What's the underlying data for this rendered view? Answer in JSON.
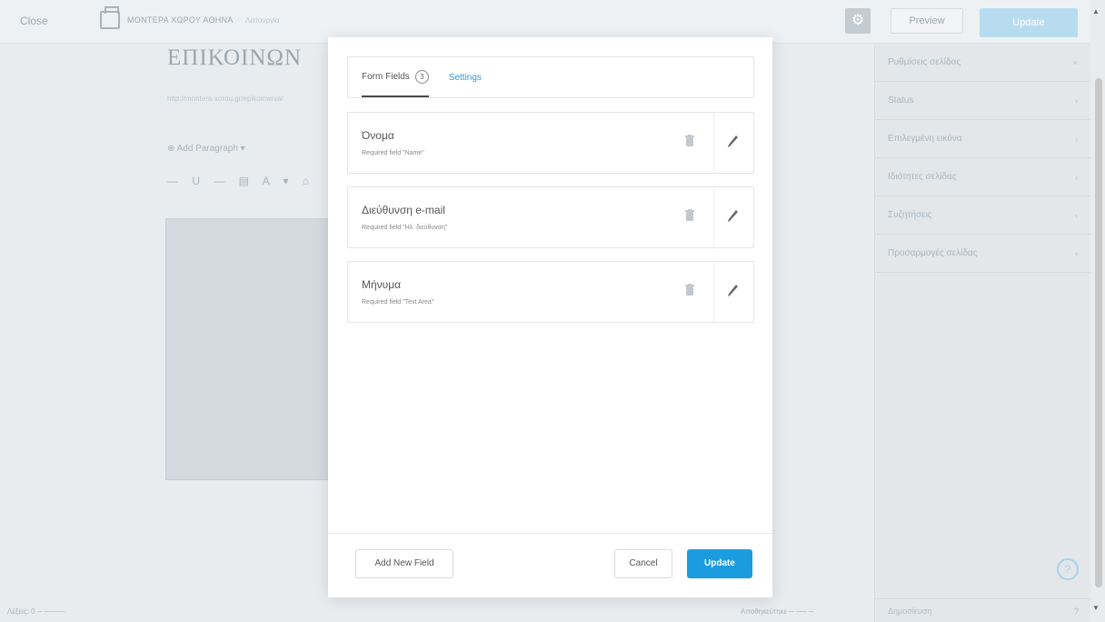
{
  "topbar": {
    "close": "Close",
    "site_name": "ΜΟΝΤΕΡΑ ΧΩΡΟΥ ΑΘΗΝΑ",
    "site_sub": "Λειτουργία",
    "preview": "Preview",
    "publish": "Update"
  },
  "editor": {
    "page_title": "ΕΠΙΚΟΙΝΩΝ",
    "permalink": "http://montera-xorou.gr/epikoinwnia/",
    "toolbar_row1": "⊕ Add   Paragraph  ▾",
    "toolbar_row2": "— U — ▤ A ▾ ⌂",
    "footer_left": "Λέξεις: 0 ─ ────",
    "footer_mid": "Αποθηκεύτηκε ─ ── ─"
  },
  "sidebar": {
    "items": [
      {
        "label": "Ρυθμίσεις σελίδας",
        "chev": "×"
      },
      {
        "label": "Status",
        "chev": "›"
      },
      {
        "label": "Επιλεγμένη εικόνα",
        "chev": "›"
      },
      {
        "label": "Ιδιότητες σελίδας",
        "chev": "›"
      },
      {
        "label": "Συζητήσεις",
        "chev": "›"
      },
      {
        "label": "Προσαρμογές σελίδας",
        "chev": "›"
      }
    ],
    "footer_label": "Δημοσίευση",
    "help": "?"
  },
  "modal": {
    "tabs": [
      {
        "label": "Form Fields",
        "count": "3"
      },
      {
        "label": "Settings"
      }
    ],
    "fields": [
      {
        "title": "Όνομα",
        "subtitle": "Required field \"Name\""
      },
      {
        "title": "Διεύθυνση e-mail",
        "subtitle": "Required field \"Ηλ. διεύθυνση\""
      },
      {
        "title": "Μήνυμα",
        "subtitle": "Required field \"Text Area\""
      }
    ],
    "footer": {
      "add_new_field": "Add New Field",
      "cancel": "Cancel",
      "update": "Update"
    }
  },
  "colors": {
    "accent": "#1b9ce0",
    "tab_link": "#2a9ad8",
    "background": "#e8ecef"
  }
}
